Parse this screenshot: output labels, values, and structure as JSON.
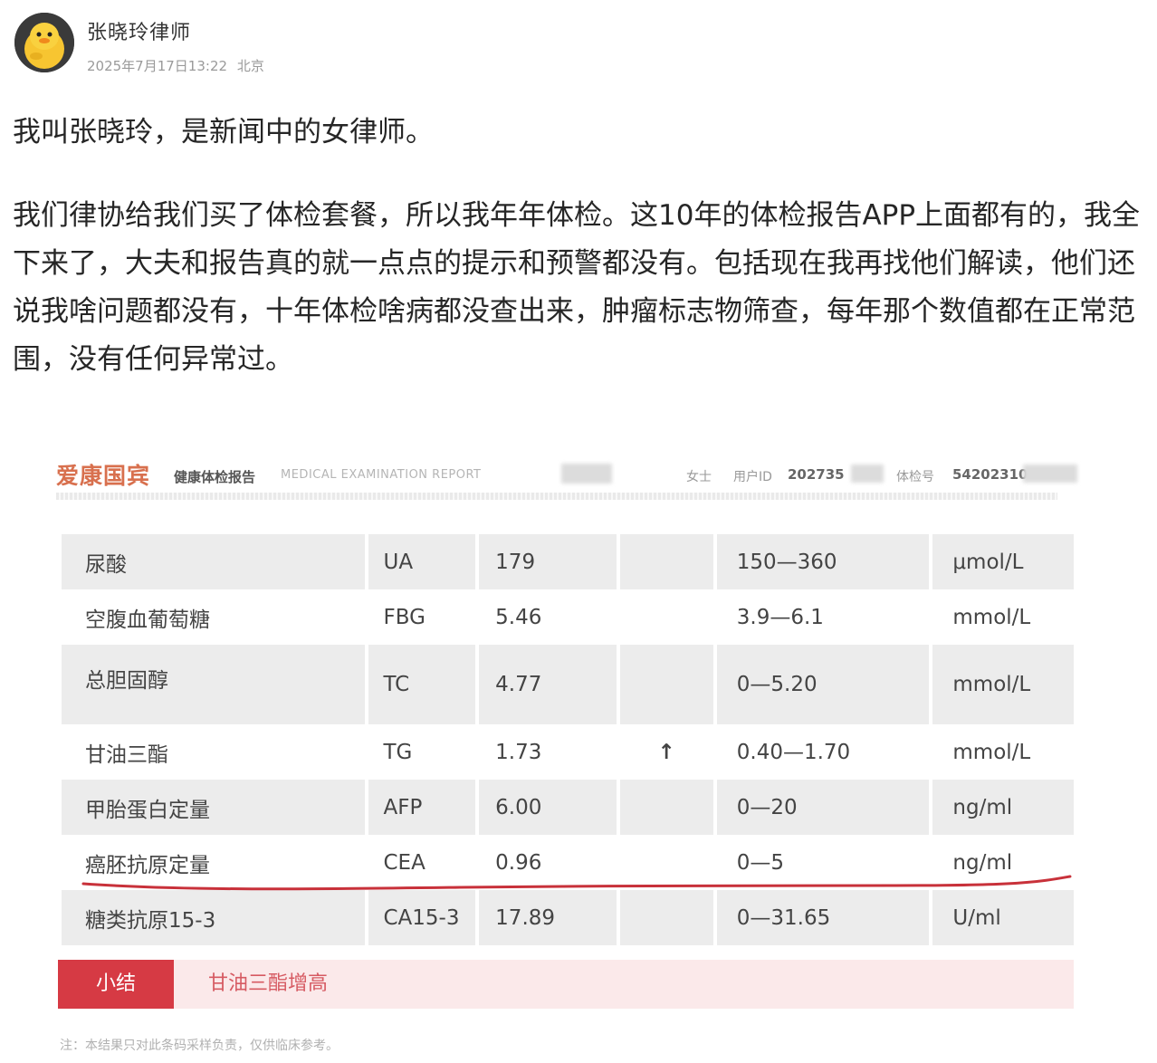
{
  "post": {
    "author": "张晓玲律师",
    "date": "2025年7月17日13:22",
    "location": "北京",
    "paragraph1": "我叫张晓玲，是新闻中的女律师。",
    "paragraph2": "我们律协给我们买了体检套餐，所以我年年体检。这10年的体检报告APP上面都有的，我全下来了，大夫和报告真的就一点点的提示和预警都没有。包括现在我再找他们解读，他们还说我啥问题都没有，十年体检啥病都没查出来，肿瘤标志物筛查，每年那个数值都在正常范围，没有任何异常过。"
  },
  "report": {
    "brand": "爱康国宾",
    "title": "健康体检报告",
    "title_en": "MEDICAL EXAMINATION REPORT",
    "gender": "女士",
    "uid_label": "用户ID",
    "uid_value": "202735",
    "exam_label": "体检号",
    "exam_value": "54202310",
    "rows": [
      {
        "name": "尿酸",
        "code": "UA",
        "value": "179",
        "flag": "",
        "range": "150—360",
        "unit": "μmol/L"
      },
      {
        "name": "空腹血葡萄糖",
        "code": "FBG",
        "value": "5.46",
        "flag": "",
        "range": "3.9—6.1",
        "unit": "mmol/L"
      },
      {
        "name": "总胆固醇",
        "code": "TC",
        "value": "4.77",
        "flag": "",
        "range": "0—5.20",
        "unit": "mmol/L"
      },
      {
        "name": "甘油三酯",
        "code": "TG",
        "value": "1.73",
        "flag": "↑",
        "range": "0.40—1.70",
        "unit": "mmol/L"
      },
      {
        "name": "甲胎蛋白定量",
        "code": "AFP",
        "value": "6.00",
        "flag": "",
        "range": "0—20",
        "unit": "ng/ml"
      },
      {
        "name": "癌胚抗原定量",
        "code": "CEA",
        "value": "0.96",
        "flag": "",
        "range": "0—5",
        "unit": "ng/ml"
      },
      {
        "name": "糖类抗原15-3",
        "code": "CA15-3",
        "value": "17.89",
        "flag": "",
        "range": "0—31.65",
        "unit": "U/ml"
      }
    ],
    "summary_tag": "小结",
    "summary_text": "甘油三酯增高",
    "note": "注：本结果只对此条码采样负责，仅供临床参考。",
    "colors": {
      "brand": "#d8704e",
      "summary_tag": "#d63a44",
      "summary_bg": "#fbe9ea",
      "flag": "#b03030",
      "underline": "#c8313a"
    }
  }
}
